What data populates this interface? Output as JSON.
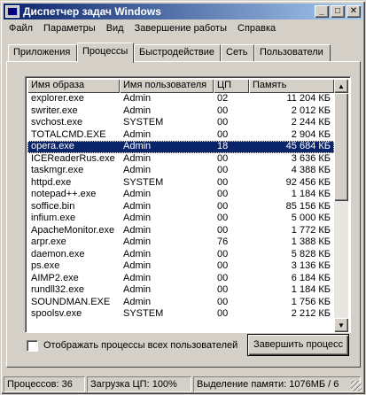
{
  "window": {
    "title": "Диспетчер задач Windows",
    "minimize": "_",
    "maximize": "□",
    "close": "✕"
  },
  "menu": [
    "Файл",
    "Параметры",
    "Вид",
    "Завершение работы",
    "Справка"
  ],
  "tabs": [
    "Приложения",
    "Процессы",
    "Быстродействие",
    "Сеть",
    "Пользователи"
  ],
  "active_tab": "Процессы",
  "columns": [
    "Имя образа",
    "Имя пользователя",
    "ЦП",
    "Память"
  ],
  "processes": [
    {
      "name": "explorer.exe",
      "user": "Admin",
      "cpu": "02",
      "mem": "11 204 КБ"
    },
    {
      "name": "swriter.exe",
      "user": "Admin",
      "cpu": "00",
      "mem": "2 012 КБ"
    },
    {
      "name": "svchost.exe",
      "user": "SYSTEM",
      "cpu": "00",
      "mem": "2 244 КБ"
    },
    {
      "name": "TOTALCMD.EXE",
      "user": "Admin",
      "cpu": "00",
      "mem": "2 904 КБ"
    },
    {
      "name": "opera.exe",
      "user": "Admin",
      "cpu": "18",
      "mem": "45 684 КБ"
    },
    {
      "name": "ICEReaderRus.exe",
      "user": "Admin",
      "cpu": "00",
      "mem": "3 636 КБ"
    },
    {
      "name": "taskmgr.exe",
      "user": "Admin",
      "cpu": "00",
      "mem": "4 388 КБ"
    },
    {
      "name": "httpd.exe",
      "user": "SYSTEM",
      "cpu": "00",
      "mem": "92 456 КБ"
    },
    {
      "name": "notepad++.exe",
      "user": "Admin",
      "cpu": "00",
      "mem": "1 184 КБ"
    },
    {
      "name": "soffice.bin",
      "user": "Admin",
      "cpu": "00",
      "mem": "85 156 КБ"
    },
    {
      "name": "infium.exe",
      "user": "Admin",
      "cpu": "00",
      "mem": "5 000 КБ"
    },
    {
      "name": "ApacheMonitor.exe",
      "user": "Admin",
      "cpu": "00",
      "mem": "1 772 КБ"
    },
    {
      "name": "arpr.exe",
      "user": "Admin",
      "cpu": "76",
      "mem": "1 388 КБ"
    },
    {
      "name": "daemon.exe",
      "user": "Admin",
      "cpu": "00",
      "mem": "5 828 КБ"
    },
    {
      "name": "ps.exe",
      "user": "Admin",
      "cpu": "00",
      "mem": "3 136 КБ"
    },
    {
      "name": "AIMP2.exe",
      "user": "Admin",
      "cpu": "00",
      "mem": "6 184 КБ"
    },
    {
      "name": "rundll32.exe",
      "user": "Admin",
      "cpu": "00",
      "mem": "1 184 КБ"
    },
    {
      "name": "SOUNDMAN.EXE",
      "user": "Admin",
      "cpu": "00",
      "mem": "1 756 КБ"
    },
    {
      "name": "spoolsv.exe",
      "user": "SYSTEM",
      "cpu": "00",
      "mem": "2 212 КБ"
    }
  ],
  "selected_process": "opera.exe",
  "show_all_label": "Отображать процессы всех пользователей",
  "show_all_checked": false,
  "end_process_label": "Завершить процесс",
  "status": {
    "processes": "Процессов: 36",
    "cpu": "Загрузка ЦП: 100%",
    "memory": "Выделение памяти: 1076МБ / 6"
  },
  "colors": {
    "face": "#d4d0c8",
    "title_start": "#0a246a",
    "title_end": "#a6caf0",
    "selection": "#0a246a"
  }
}
